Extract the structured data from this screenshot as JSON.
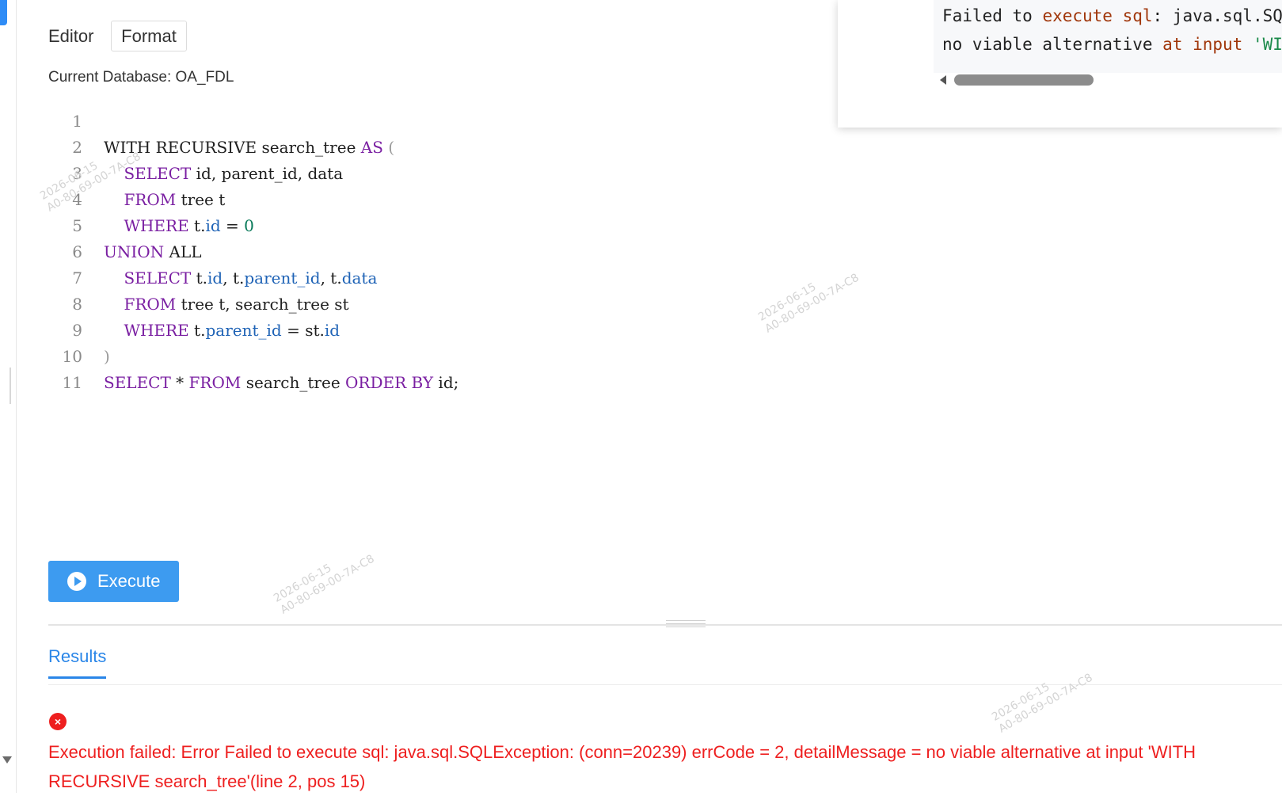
{
  "toolbar": {
    "editor_label": "Editor",
    "format_label": "Format"
  },
  "current_database": "Current Database: OA_FDL",
  "editor": {
    "line_numbers": [
      "1",
      "2",
      "3",
      "4",
      "5",
      "6",
      "7",
      "8",
      "9",
      "10",
      "11"
    ]
  },
  "tooltip": {
    "line1": {
      "a": "Failed to ",
      "kw": "execute sql",
      "b": ": java.sql.SQ"
    },
    "line2": {
      "a": "no viable alternative ",
      "kw": "at input",
      "b": " ",
      "str": "'WI"
    }
  },
  "execute_label": "Execute",
  "results": {
    "tab_label": "Results",
    "error_icon": "×",
    "error_message": "Execution failed: Error Failed to execute sql: java.sql.SQLException: (conn=20239) errCode = 2, detailMessage = no viable alternative at input 'WITH RECURSIVE search_tree'(line 2, pos 15)"
  },
  "watermark": {
    "date": "2026-06-15",
    "id": "A0-80-69-00-7A-C8"
  },
  "colors": {
    "accent": "#3d9bf0",
    "error": "#ee1f1f",
    "keyword": "#7a1fa2",
    "property": "#1f63b6"
  }
}
